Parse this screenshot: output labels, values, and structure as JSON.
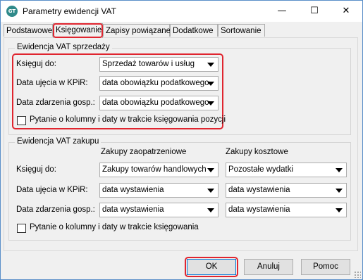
{
  "window": {
    "title": "Parametry ewidencji VAT",
    "icon": "app-logo-icon",
    "controls": {
      "minimize": "—",
      "maximize": "☐",
      "close": "✕"
    }
  },
  "tabs": [
    {
      "label": "Podstawowe",
      "active": false
    },
    {
      "label": "Księgowanie",
      "active": true
    },
    {
      "label": "Zapisy powiązane",
      "active": false
    },
    {
      "label": "Dodatkowe",
      "active": false
    },
    {
      "label": "Sortowanie",
      "active": false
    }
  ],
  "sales": {
    "legend": "Ewidencja VAT sprzedaży",
    "book_to": {
      "label": "Księguj do:",
      "value": "Sprzedaż towarów i usług"
    },
    "kpir_date": {
      "label": "Data ujęcia w KPiR:",
      "value": "data obowiązku podatkowego"
    },
    "event_date": {
      "label": "Data zdarzenia gosp.:",
      "value": "data obowiązku podatkowego"
    },
    "ask_checkbox": {
      "label": "Pytanie o kolumny i daty w trakcie księgowania pozycji",
      "checked": false
    }
  },
  "purchase": {
    "legend": "Ewidencja VAT zakupu",
    "col_supply": "Zakupy zaopatrzeniowe",
    "col_cost": "Zakupy kosztowe",
    "book_to": {
      "label": "Księguj do:",
      "supply": "Zakupy towarów handlowych",
      "cost": "Pozostałe wydatki"
    },
    "kpir_date": {
      "label": "Data ujęcia w KPiR:",
      "supply": "data wystawienia",
      "cost": "data wystawienia"
    },
    "event_date": {
      "label": "Data zdarzenia gosp.:",
      "supply": "data wystawienia",
      "cost": "data wystawienia"
    },
    "ask_checkbox": {
      "label": "Pytanie o kolumny i daty w trakcie księgowania",
      "checked": false
    }
  },
  "buttons": {
    "ok": "OK",
    "cancel": "Anuluj",
    "help": "Pomoc"
  },
  "colors": {
    "highlight": "#e0252f",
    "accent": "#0078d7"
  }
}
